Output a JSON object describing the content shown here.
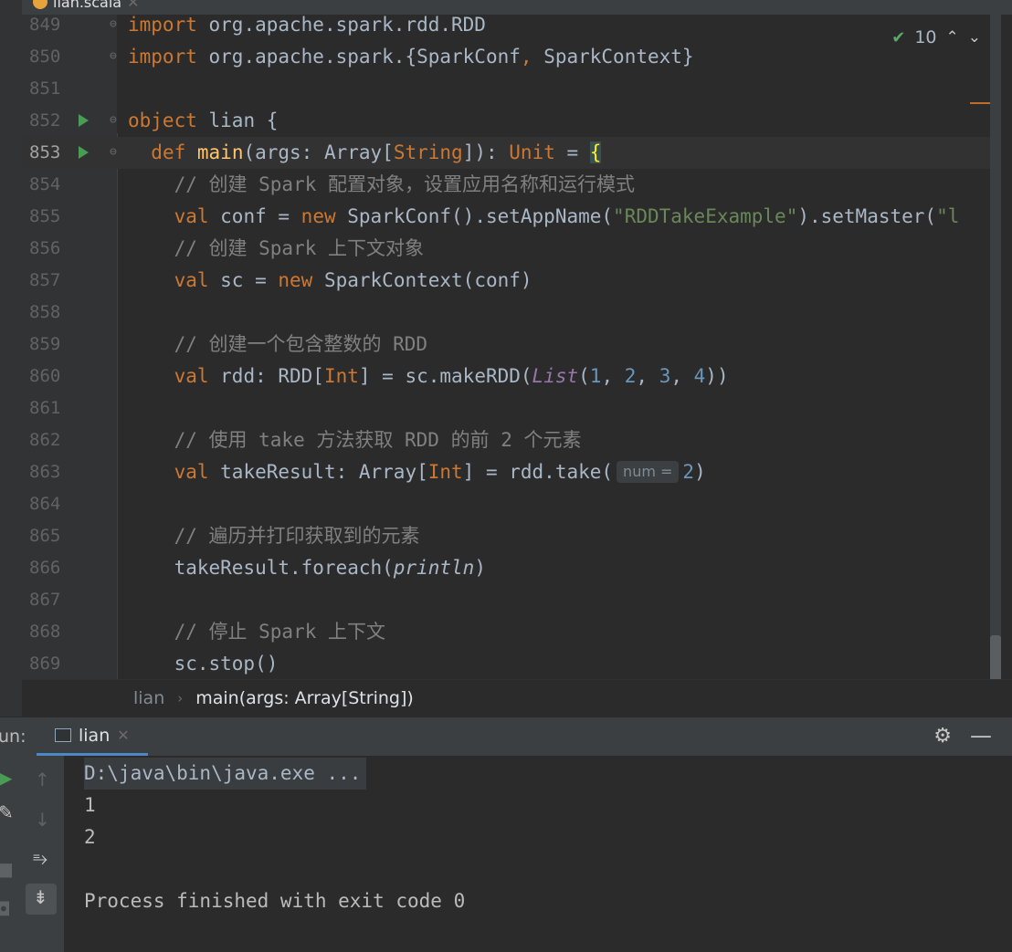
{
  "file_tab": {
    "name": "lian.scala"
  },
  "inspection": {
    "count": "10"
  },
  "lines": [
    {
      "num": "849",
      "text": "import org.apache.spark.rdd.RDD"
    },
    {
      "num": "850",
      "text": "import org.apache.spark.{SparkConf, SparkContext}"
    },
    {
      "num": "851",
      "text": ""
    },
    {
      "num": "852",
      "text": "object lian {"
    },
    {
      "num": "853",
      "text": "  def main(args: Array[String]): Unit = {"
    },
    {
      "num": "854",
      "text": "    // 创建 Spark 配置对象，设置应用名称和运行模式"
    },
    {
      "num": "855",
      "text": "    val conf = new SparkConf().setAppName(\"RDDTakeExample\").setMaster(\"l"
    },
    {
      "num": "856",
      "text": "    // 创建 Spark 上下文对象"
    },
    {
      "num": "857",
      "text": "    val sc = new SparkContext(conf)"
    },
    {
      "num": "858",
      "text": ""
    },
    {
      "num": "859",
      "text": "    // 创建一个包含整数的 RDD"
    },
    {
      "num": "860",
      "text": "    val rdd: RDD[Int] = sc.makeRDD(List(1, 2, 3, 4))"
    },
    {
      "num": "861",
      "text": ""
    },
    {
      "num": "862",
      "text": "    // 使用 take 方法获取 RDD 的前 2 个元素"
    },
    {
      "num": "863",
      "text": "    val takeResult: Array[Int] = rdd.take(num = 2)"
    },
    {
      "num": "864",
      "text": ""
    },
    {
      "num": "865",
      "text": "    // 遍历并打印获取到的元素"
    },
    {
      "num": "866",
      "text": "    takeResult.foreach(println)"
    },
    {
      "num": "867",
      "text": ""
    },
    {
      "num": "868",
      "text": "    // 停止 Spark 上下文"
    },
    {
      "num": "869",
      "text": "    sc.stop()"
    }
  ],
  "hint": {
    "label": "num ="
  },
  "breadcrumb": {
    "items": [
      "lian",
      "main(args: Array[String])"
    ]
  },
  "run_panel": {
    "label": "un:",
    "tab_label": "lian"
  },
  "console": {
    "command": "D:\\java\\bin\\java.exe ...",
    "lines": [
      "1",
      "2"
    ],
    "exit_message": "Process finished with exit code 0"
  },
  "icons": {
    "tab_file": "scala-file-icon",
    "run_gutter": "run-gutter-icon",
    "inspection": "check-icon",
    "settings": "gear-icon",
    "hide": "minus-icon"
  },
  "colors": {
    "background": "#2b2b2b",
    "keyword": "#cc7832",
    "string": "#6a8759",
    "comment": "#808080",
    "number": "#6897bb",
    "function": "#ffc66d",
    "accent": "#4a88c7"
  }
}
